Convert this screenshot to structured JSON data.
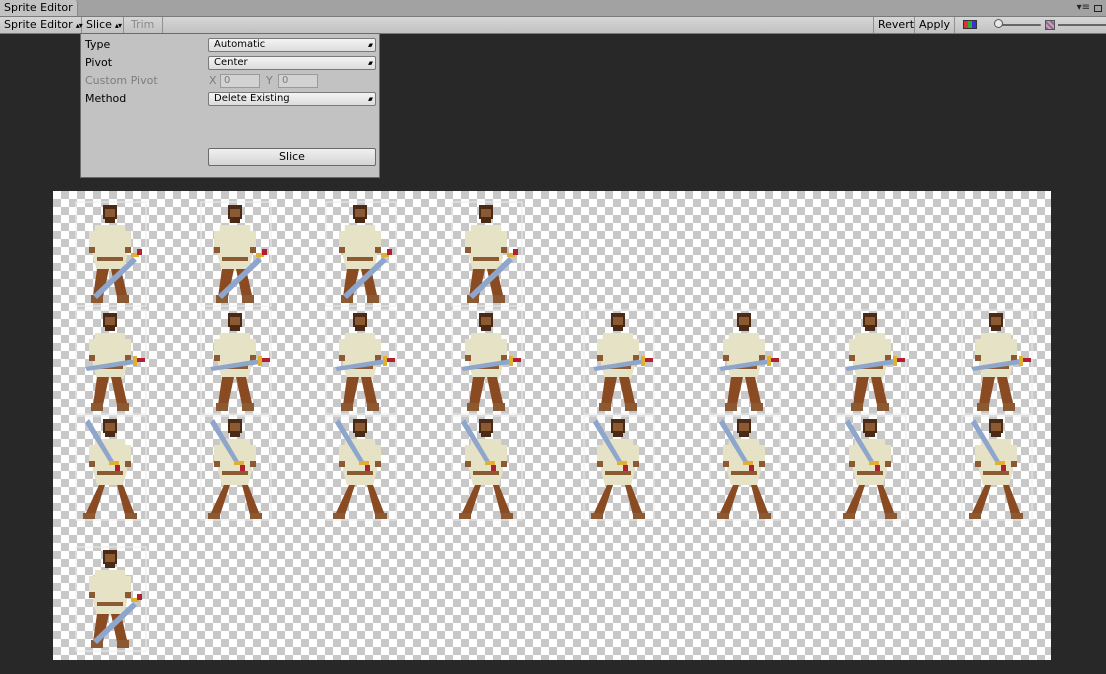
{
  "window": {
    "tab_title": "Sprite Editor",
    "icons": [
      "menu-icon",
      "maximize-icon"
    ]
  },
  "toolbar": {
    "mode_label": "Sprite Editor",
    "slice_label": "Slice",
    "trim_label": "Trim",
    "revert_label": "Revert",
    "apply_label": "Apply",
    "zoom_level": 0.05
  },
  "slice_panel": {
    "type_label": "Type",
    "type_value": "Automatic",
    "pivot_label": "Pivot",
    "pivot_value": "Center",
    "custom_pivot_label": "Custom Pivot",
    "x_label": "X",
    "x_value": "0",
    "y_label": "Y",
    "y_value": "0",
    "method_label": "Method",
    "method_value": "Delete Existing",
    "slice_button_label": "Slice"
  },
  "sheet": {
    "rows": [
      {
        "count": 4,
        "pose": "idle"
      },
      {
        "count": 8,
        "pose": "lunge"
      },
      {
        "count": 8,
        "pose": "overhead"
      },
      {
        "count": 1,
        "pose": "idle"
      }
    ],
    "colors": {
      "skin": "#8c5a32",
      "shirt": "#e6e2c6",
      "pants": "#8a4a22",
      "hair": "#4a2a14",
      "blade": "#8ea6cc",
      "hilt": "#e0b030",
      "grip": "#b02030",
      "slice_outline": "#eeeeee"
    }
  }
}
